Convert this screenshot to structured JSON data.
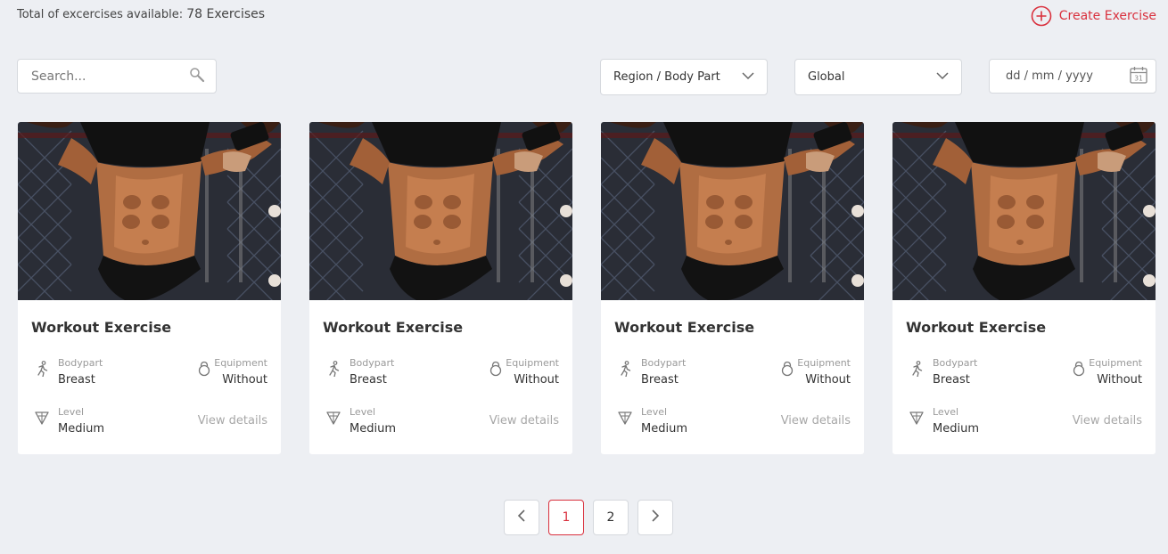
{
  "header": {
    "total_label": "Total of excercises available:",
    "total_count": "78 Exercises",
    "create_label": "Create Exercise"
  },
  "filters": {
    "search_placeholder": "Search...",
    "region": "Region / Body Part",
    "scope": "Global",
    "date_placeholder": "dd / mm / yyyy"
  },
  "cards": [
    {
      "title": "Workout Exercise",
      "bodypart_label": "Bodypart",
      "bodypart": "Breast",
      "equipment_label": "Equipment",
      "equipment": "Without",
      "level_label": "Level",
      "level": "Medium",
      "link": "View details"
    },
    {
      "title": "Workout Exercise",
      "bodypart_label": "Bodypart",
      "bodypart": "Breast",
      "equipment_label": "Equipment",
      "equipment": "Without",
      "level_label": "Level",
      "level": "Medium",
      "link": "View details"
    },
    {
      "title": "Workout Exercise",
      "bodypart_label": "Bodypart",
      "bodypart": "Breast",
      "equipment_label": "Equipment",
      "equipment": "Without",
      "level_label": "Level",
      "level": "Medium",
      "link": "View details"
    },
    {
      "title": "Workout Exercise",
      "bodypart_label": "Bodypart",
      "bodypart": "Breast",
      "equipment_label": "Equipment",
      "equipment": "Without",
      "level_label": "Level",
      "level": "Medium",
      "link": "View details"
    }
  ],
  "pagination": {
    "pages": [
      "1",
      "2"
    ],
    "current": "1"
  },
  "colors": {
    "accent": "#d9303d",
    "background": "#edeff3"
  }
}
